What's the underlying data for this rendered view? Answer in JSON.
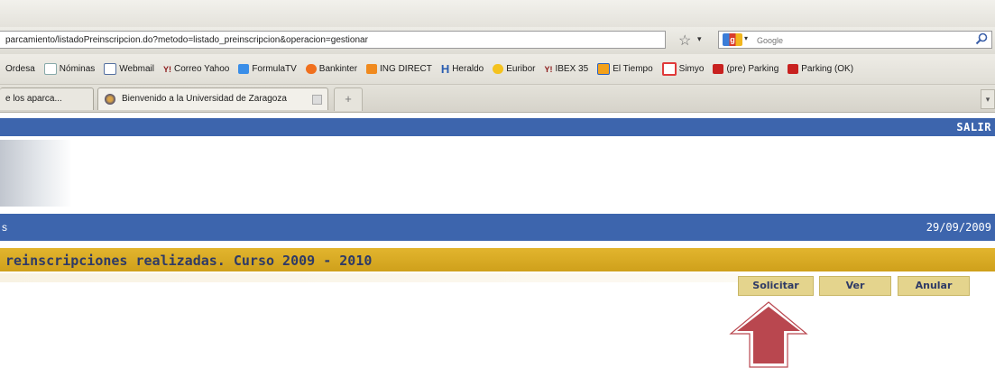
{
  "browser": {
    "url": "parcamiento/listadoPreinscripcion.do?metodo=listado_preinscripcion&operacion=gestionar",
    "search": {
      "engine": "g",
      "placeholder": "Google"
    },
    "bookmarks": [
      {
        "label": "Ordesa",
        "icon": "none"
      },
      {
        "label": "Nóminas",
        "icon": "page-icon"
      },
      {
        "label": "Webmail",
        "icon": "mail-icon"
      },
      {
        "label": "Correo Yahoo",
        "icon": "yahoo-icon"
      },
      {
        "label": "FormulaTV",
        "icon": "tv-icon"
      },
      {
        "label": "Bankinter",
        "icon": "bankinter-icon"
      },
      {
        "label": "ING DIRECT",
        "icon": "ing-icon"
      },
      {
        "label": "Heraldo",
        "icon": "heraldo-icon"
      },
      {
        "label": "Euribor",
        "icon": "euribor-icon"
      },
      {
        "label": "IBEX 35",
        "icon": "yahoo-icon"
      },
      {
        "label": "El Tiempo",
        "icon": "weather-icon"
      },
      {
        "label": "Simyo",
        "icon": "simyo-icon"
      },
      {
        "label": "(pre) Parking",
        "icon": "parking-icon"
      },
      {
        "label": "Parking (OK)",
        "icon": "parking-icon"
      }
    ],
    "tabs": [
      {
        "label": "e los aparca..."
      },
      {
        "label": "Bienvenido a la Universidad de Zaragoza"
      }
    ],
    "new_tab_label": "+",
    "yahoo_glyph": "Y!",
    "heraldo_glyph": "H",
    "tab_scroll_glyph": "▾",
    "star_glyph": "☆",
    "drop_glyph": "▾"
  },
  "page": {
    "logout_label": "SALIR",
    "datebar_left": "s",
    "date": "29/09/2009",
    "section_title": "reinscripciones realizadas. Curso 2009 - 2010",
    "buttons": {
      "solicitar": "Solicitar",
      "ver": "Ver",
      "anular": "Anular"
    },
    "colors": {
      "header_blue": "#3d65ad",
      "title_yellow": "#d4a722",
      "button_bg": "#e4d48d",
      "arrow_red": "#b9474f"
    }
  }
}
